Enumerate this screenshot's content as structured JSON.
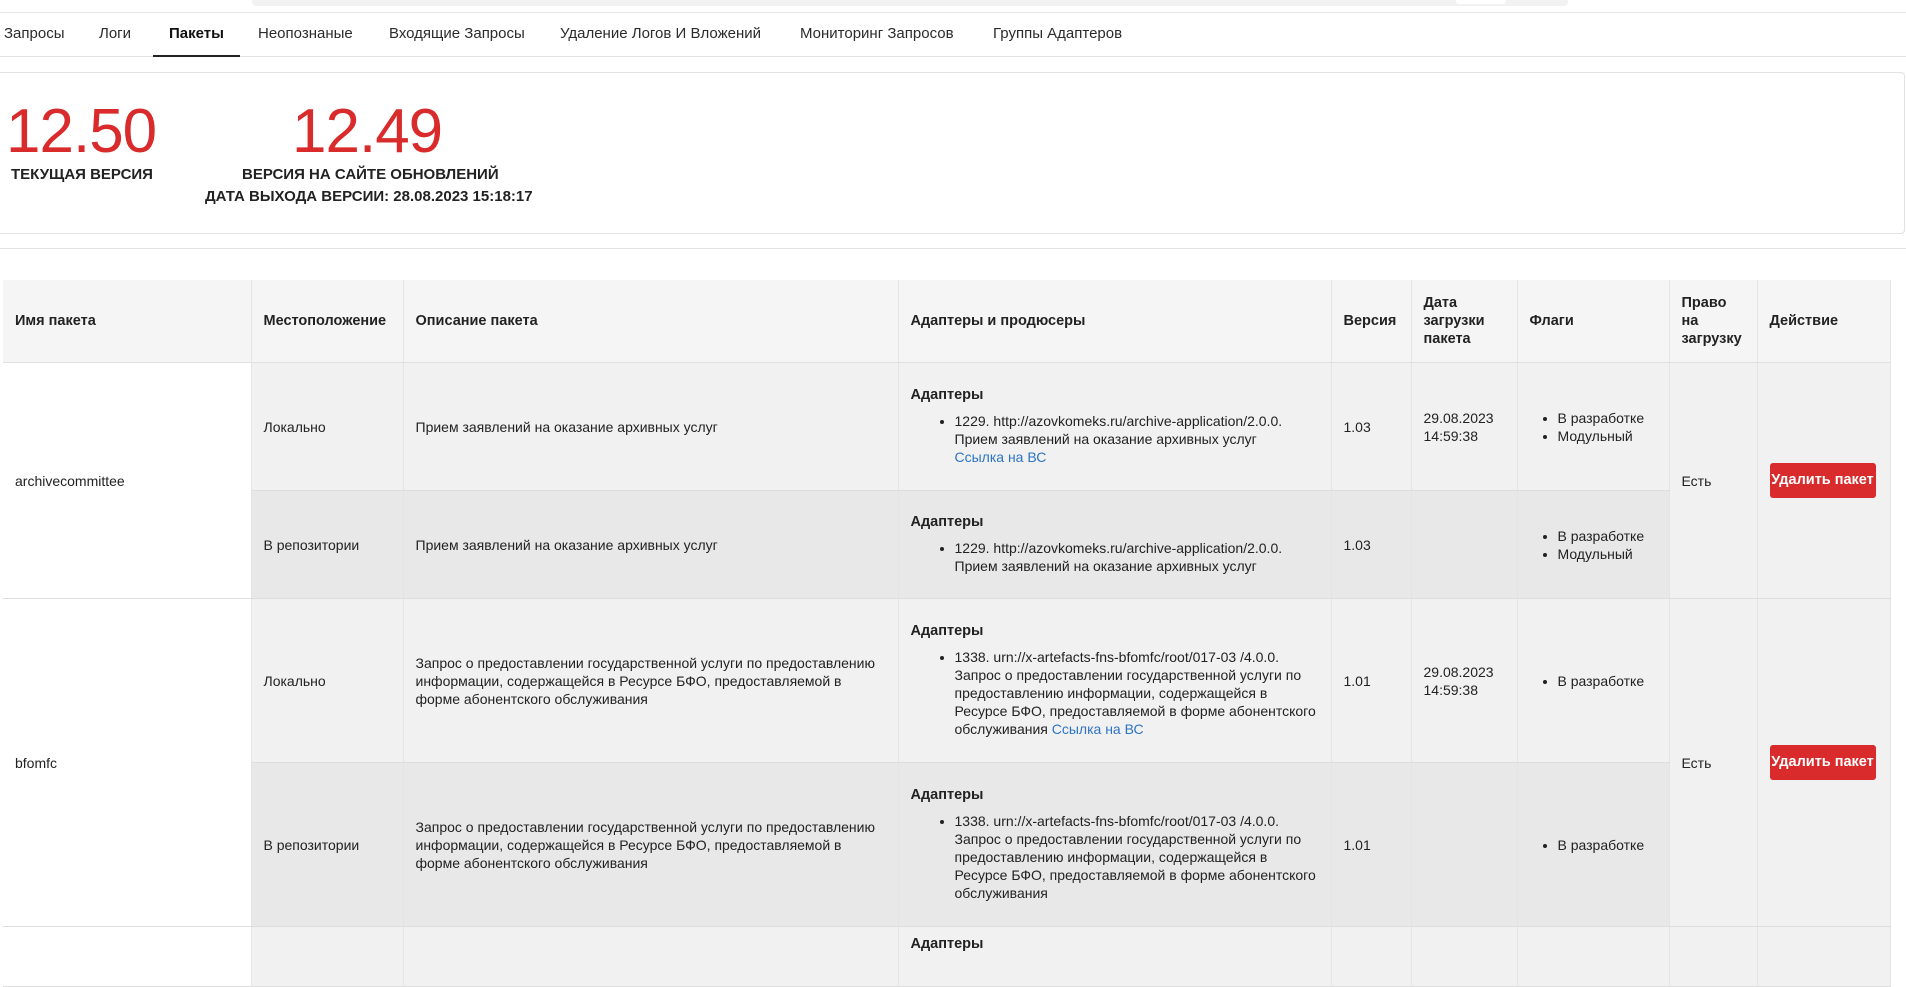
{
  "tabs": [
    {
      "label": "Запросы"
    },
    {
      "label": "Логи"
    },
    {
      "label": "Пакеты",
      "active": true
    },
    {
      "label": "Неопознаные"
    },
    {
      "label": "Входящие Запросы"
    },
    {
      "label": "Удаление Логов И Вложений"
    },
    {
      "label": "Мониторинг Запросов"
    },
    {
      "label": "Группы Адаптеров"
    }
  ],
  "versions": {
    "current_value": "12.50",
    "current_label": "ТЕКУЩАЯ ВЕРСИЯ",
    "site_value": "12.49",
    "site_label": "ВЕРСИЯ НА САЙТЕ ОБНОВЛЕНИЙ",
    "release_label": "ДАТА ВЫХОДА ВЕРСИИ: 28.08.2023 15:18:17"
  },
  "table": {
    "headers": {
      "name": "Имя пакета",
      "location": "Местоположение",
      "description": "Описание пакета",
      "adapters": "Адаптеры и продюсеры",
      "version": "Версия",
      "upload_date": "Дата загрузки пакета",
      "flags": "Флаги",
      "right": "Право на загрузку",
      "action": "Действие"
    },
    "adapters_heading": "Адаптеры",
    "bc_link_label": "Ссылка на ВС",
    "delete_label": "Удалить пакет",
    "packages": [
      {
        "name": "archivecommittee",
        "right": "Есть",
        "rows": [
          {
            "location": "Локально",
            "description": "Прием заявлений на оказание архивных услуг",
            "adapter": "1229. http://azovkomeks.ru/archive-application/2.0.0. Прием заявлений на оказание архивных услуг",
            "version": "1.03",
            "date": "29.08.2023 14:59:38",
            "flags": [
              "В разработке",
              "Модульный"
            ]
          },
          {
            "location": "В репозитории",
            "description": "Прием заявлений на оказание архивных услуг",
            "adapter": "1229. http://azovkomeks.ru/archive-application/2.0.0. Прием заявлений на оказание архивных услуг",
            "version": "1.03",
            "date": "",
            "flags": [
              "В разработке",
              "Модульный"
            ]
          }
        ]
      },
      {
        "name": "bfomfc",
        "right": "Есть",
        "rows": [
          {
            "location": "Локально",
            "description": "Запрос о предоставлении государственной услуги по предоставлению информации, содержащейся в Ресурсе БФО, предоставляемой в форме абонентского обслуживания",
            "adapter": "1338. urn://x-artefacts-fns-bfomfc/root/017-03 /4.0.0. Запрос о предоставлении государственной услуги по предоставлению информации, содержащейся в Ресурсе БФО, предоставляемой в форме абонентского обслуживания",
            "version": "1.01",
            "date": "29.08.2023 14:59:38",
            "flags": [
              "В разработке"
            ]
          },
          {
            "location": "В репозитории",
            "description": "Запрос о предоставлении государственной услуги по предоставлению информации, содержащейся в Ресурсе БФО, предоставляемой в форме абонентского обслуживания",
            "adapter": "1338. urn://x-artefacts-fns-bfomfc/root/017-03 /4.0.0. Запрос о предоставлении государственной услуги по предоставлению информации, содержащейся в Ресурсе БФО, предоставляемой в форме абонентского обслуживания",
            "version": "1.01",
            "date": "",
            "flags": [
              "В разработке"
            ]
          }
        ]
      }
    ]
  }
}
